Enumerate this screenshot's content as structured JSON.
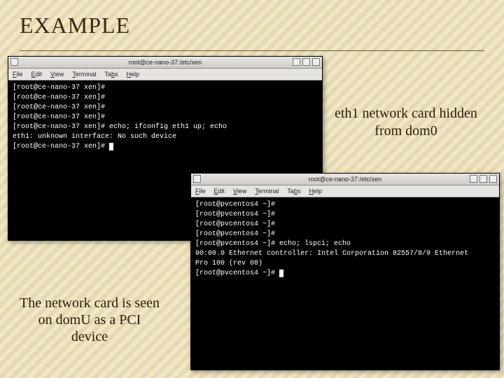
{
  "title": "EXAMPLE",
  "callouts": {
    "right": "eth1 network card hidden from dom0",
    "left": "The network card is seen on domU as a PCI device"
  },
  "win_a": {
    "title": "root@ce-nano-37:/etc/xen",
    "menu": {
      "file": "File",
      "edit": "Edit",
      "view": "View",
      "terminal": "Terminal",
      "tabs": "Tabs",
      "help": "Help"
    },
    "lines": [
      "[root@ce-nano-37 xen]#",
      "[root@ce-nano-37 xen]#",
      "[root@ce-nano-37 xen]#",
      "[root@ce-nano-37 xen]#",
      "[root@ce-nano-37 xen]# echo; ifconfig eth1 up; echo",
      "",
      "eth1: unknown interface: No such device",
      "",
      "[root@ce-nano-37 xen]# "
    ]
  },
  "win_b": {
    "title": "root@ce-nano-37:/etc/xen",
    "menu": {
      "file": "File",
      "edit": "Edit",
      "view": "View",
      "terminal": "Terminal",
      "tags": "Tabs",
      "help": "Help"
    },
    "lines": [
      "[root@pvcentos4 ~]#",
      "[root@pvcentos4 ~]#",
      "[root@pvcentos4 ~]#",
      "[root@pvcentos4 ~]#",
      "[root@pvcentos4 ~]# echo; lspci; echo",
      "",
      "00:00.0 Ethernet controller: Intel Corporation 82557/8/9 Ethernet",
      "Pro 100 (rev 08)",
      "",
      "[root@pvcentos4 ~]# "
    ]
  }
}
